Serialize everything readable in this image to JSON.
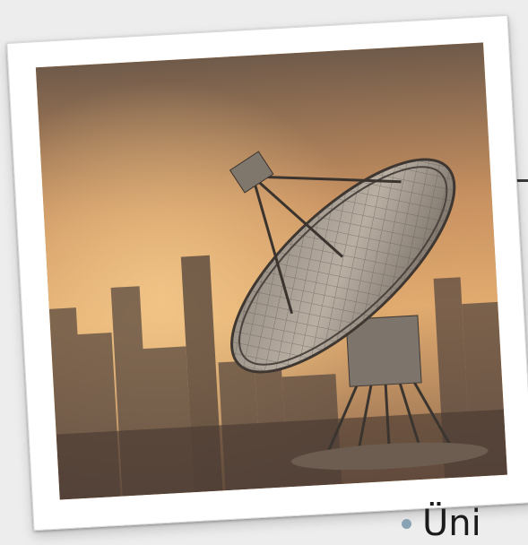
{
  "slide": {
    "bullet_text": "Üni"
  },
  "image": {
    "subject": "satellite-dish-photo"
  },
  "colors": {
    "background": "#ededed",
    "frame": "#ffffff",
    "bullet": "#8aa3b4",
    "text": "#1b1b1b"
  }
}
